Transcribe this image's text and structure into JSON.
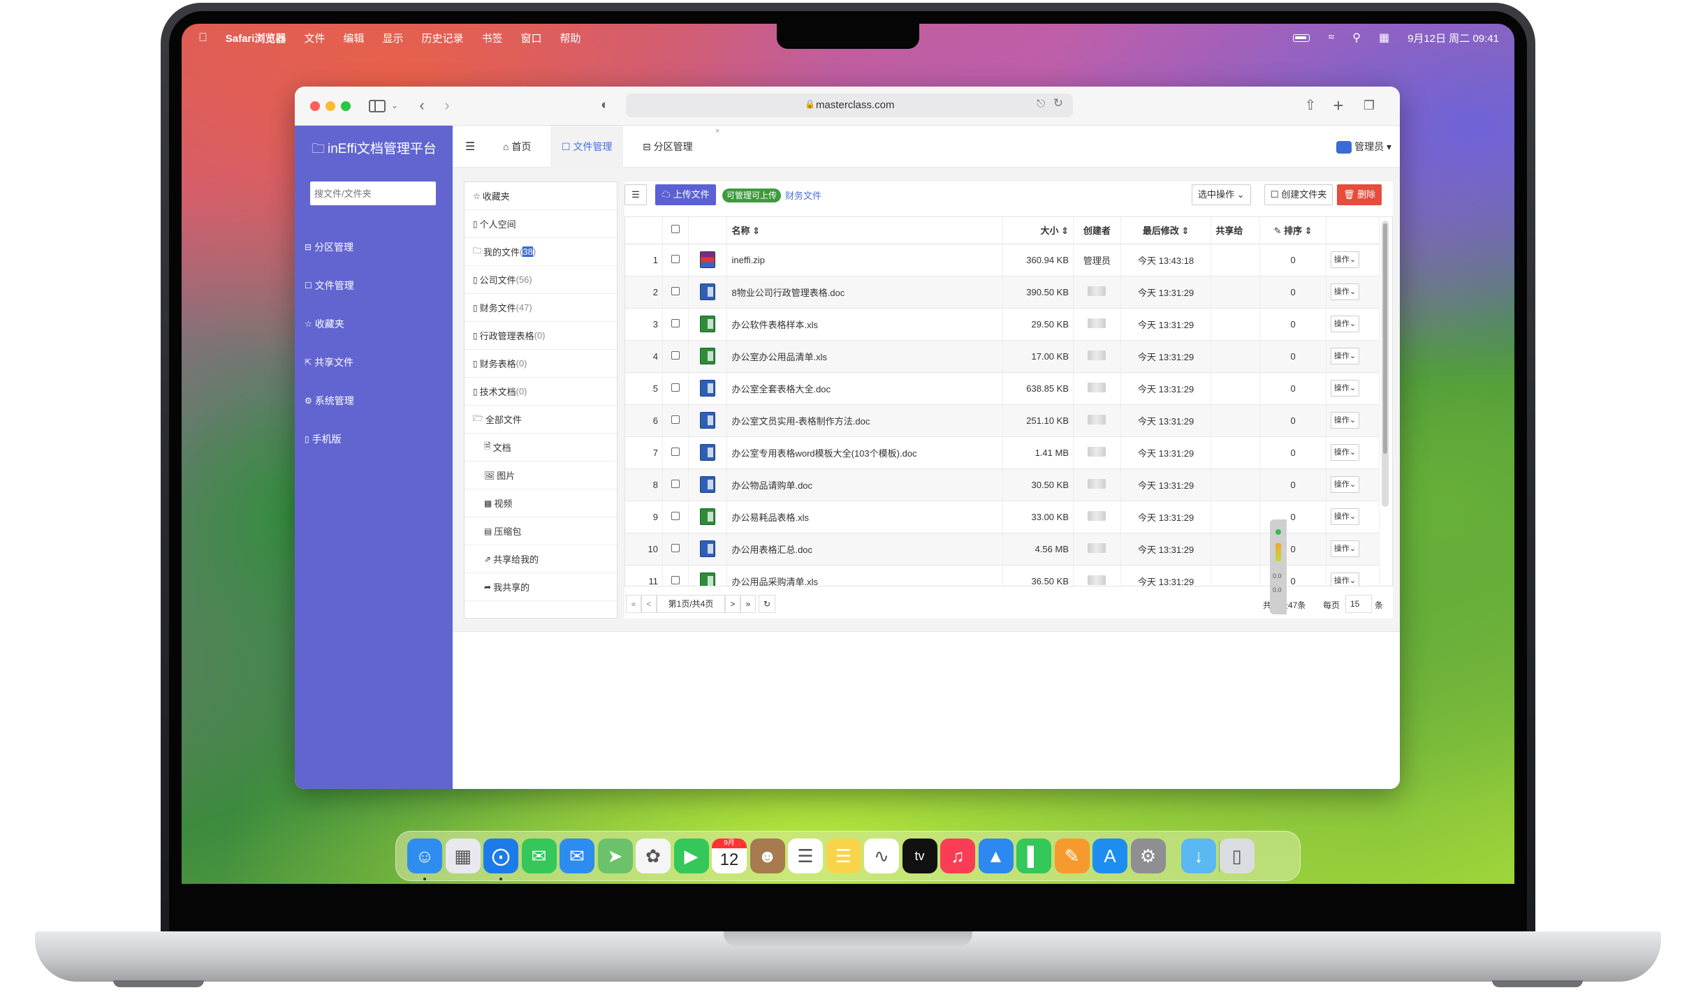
{
  "menubar": {
    "app_name": "Safari浏览器",
    "items": [
      "文件",
      "编辑",
      "显示",
      "历史记录",
      "书签",
      "窗口",
      "帮助"
    ],
    "datetime": "9月12日 周二  09:41"
  },
  "browser": {
    "url": "masterclass.com"
  },
  "app": {
    "brand": "inEffi文档管理平台",
    "search_placeholder": "搜文件/文件夹",
    "nav": [
      {
        "icon": "⊟",
        "label": "分区管理"
      },
      {
        "icon": "☐",
        "label": "文件管理"
      },
      {
        "icon": "☆",
        "label": "收藏夹"
      },
      {
        "icon": "⇱",
        "label": "共享文件"
      },
      {
        "icon": "⚙",
        "label": "系统管理"
      },
      {
        "icon": "▯",
        "label": "手机版"
      }
    ],
    "tabs": {
      "home": "首页",
      "files": "文件管理",
      "zones": "分区管理",
      "close": "×"
    },
    "user": "管理员"
  },
  "folders": {
    "favorites": "收藏夹",
    "personal": "个人空间",
    "my_files": {
      "label": "我的文件",
      "count_prefix": "(",
      "count": "38",
      "count_suffix": ")"
    },
    "company": {
      "label": "公司文件",
      "count": "(56)"
    },
    "finance": {
      "label": "财务文件",
      "count": "(47)"
    },
    "admin_sheets": {
      "label": "行政管理表格",
      "count": "(0)"
    },
    "finance_sheets": {
      "label": "财务表格",
      "count": "(0)"
    },
    "tech_docs": {
      "label": "技术文档",
      "count": "(0)"
    },
    "all_files": "全部文件",
    "types": [
      "文档",
      "图片",
      "视频",
      "压缩包"
    ],
    "shared_to_me": "共享给我的",
    "my_shared": "我共享的"
  },
  "toolbar": {
    "upload": "上传文件",
    "permission_badge": "可管理可上传",
    "current_folder": "财务文件",
    "select_ops": "选中操作",
    "new_folder": "创建文件夹",
    "delete": "删除"
  },
  "table": {
    "headers": {
      "name": "名称 ⇕",
      "size": "大小 ⇕",
      "creator": "创建者",
      "modified": "最后修改 ⇕",
      "share": "共享给",
      "sort": "✎ 排序 ⇕"
    },
    "op_label": "操作",
    "rows": [
      {
        "n": "1",
        "type": "zip",
        "name": "ineffi.zip",
        "size": "360.94 KB",
        "creator": "管理员",
        "modified": "今天 13:43:18",
        "sort": "0"
      },
      {
        "n": "2",
        "type": "doc",
        "name": "8物业公司行政管理表格.doc",
        "size": "390.50 KB",
        "creator": "",
        "modified": "今天 13:31:29",
        "sort": "0"
      },
      {
        "n": "3",
        "type": "xls",
        "name": "办公软件表格样本.xls",
        "size": "29.50 KB",
        "creator": "",
        "modified": "今天 13:31:29",
        "sort": "0"
      },
      {
        "n": "4",
        "type": "xls",
        "name": "办公室办公用品清单.xls",
        "size": "17.00 KB",
        "creator": "",
        "modified": "今天 13:31:29",
        "sort": "0"
      },
      {
        "n": "5",
        "type": "doc",
        "name": "办公室全套表格大全.doc",
        "size": "638.85 KB",
        "creator": "",
        "modified": "今天 13:31:29",
        "sort": "0"
      },
      {
        "n": "6",
        "type": "doc",
        "name": "办公室文员实用-表格制作方法.doc",
        "size": "251.10 KB",
        "creator": "",
        "modified": "今天 13:31:29",
        "sort": "0"
      },
      {
        "n": "7",
        "type": "doc",
        "name": "办公室专用表格word模板大全(103个模板).doc",
        "size": "1.41 MB",
        "creator": "",
        "modified": "今天 13:31:29",
        "sort": "0"
      },
      {
        "n": "8",
        "type": "doc",
        "name": "办公物品请购单.doc",
        "size": "30.50 KB",
        "creator": "",
        "modified": "今天 13:31:29",
        "sort": "0"
      },
      {
        "n": "9",
        "type": "xls",
        "name": "办公易耗品表格.xls",
        "size": "33.00 KB",
        "creator": "",
        "modified": "今天 13:31:29",
        "sort": "0"
      },
      {
        "n": "10",
        "type": "doc",
        "name": "办公用表格汇总.doc",
        "size": "4.56 MB",
        "creator": "",
        "modified": "今天 13:31:29",
        "sort": "0"
      },
      {
        "n": "11",
        "type": "xls",
        "name": "办公用品采购清单.xls",
        "size": "36.50 KB",
        "creator": "",
        "modified": "今天 13:31:29",
        "sort": "0"
      }
    ]
  },
  "pager": {
    "first": "«",
    "prev": "<",
    "info": "第1页/共4页",
    "next": ">",
    "last": "»",
    "refresh": "↻",
    "total": "共记录47条",
    "per_page_label": "每页",
    "per_page": "15",
    "unit": "条"
  },
  "side_widget": {
    "v1": "0.0",
    "v2": "0.0"
  },
  "dock": {
    "calendar_month": "9月",
    "calendar_day": "12",
    "tv_label": "tv",
    "apps": [
      {
        "name": "finder",
        "color": "#2f8cf0"
      },
      {
        "name": "launchpad",
        "color": "#e8e8ee"
      },
      {
        "name": "safari",
        "color": "#1c7be8"
      },
      {
        "name": "messages",
        "color": "#35c759"
      },
      {
        "name": "mail",
        "color": "#2d8cf0"
      },
      {
        "name": "maps",
        "color": "#6cc26a"
      },
      {
        "name": "photos",
        "color": "#f5f5f5"
      },
      {
        "name": "facetime",
        "color": "#34c759"
      },
      {
        "name": "calendar",
        "color": "#ffffff"
      },
      {
        "name": "contacts",
        "color": "#a77a4f"
      },
      {
        "name": "reminders",
        "color": "#ffffff"
      },
      {
        "name": "notes",
        "color": "#f8d44a"
      },
      {
        "name": "freeform",
        "color": "#ffffff"
      },
      {
        "name": "tv",
        "color": "#111111"
      },
      {
        "name": "music",
        "color": "#fa3d55"
      },
      {
        "name": "keynote",
        "color": "#2d89ef"
      },
      {
        "name": "numbers",
        "color": "#34c759"
      },
      {
        "name": "pages",
        "color": "#f79a2e"
      },
      {
        "name": "app-store",
        "color": "#1d8df0"
      },
      {
        "name": "system-settings",
        "color": "#8e8e93"
      },
      {
        "name": "downloads",
        "color": "#5ab8f2"
      },
      {
        "name": "trash",
        "color": "#d9dde0"
      }
    ]
  }
}
